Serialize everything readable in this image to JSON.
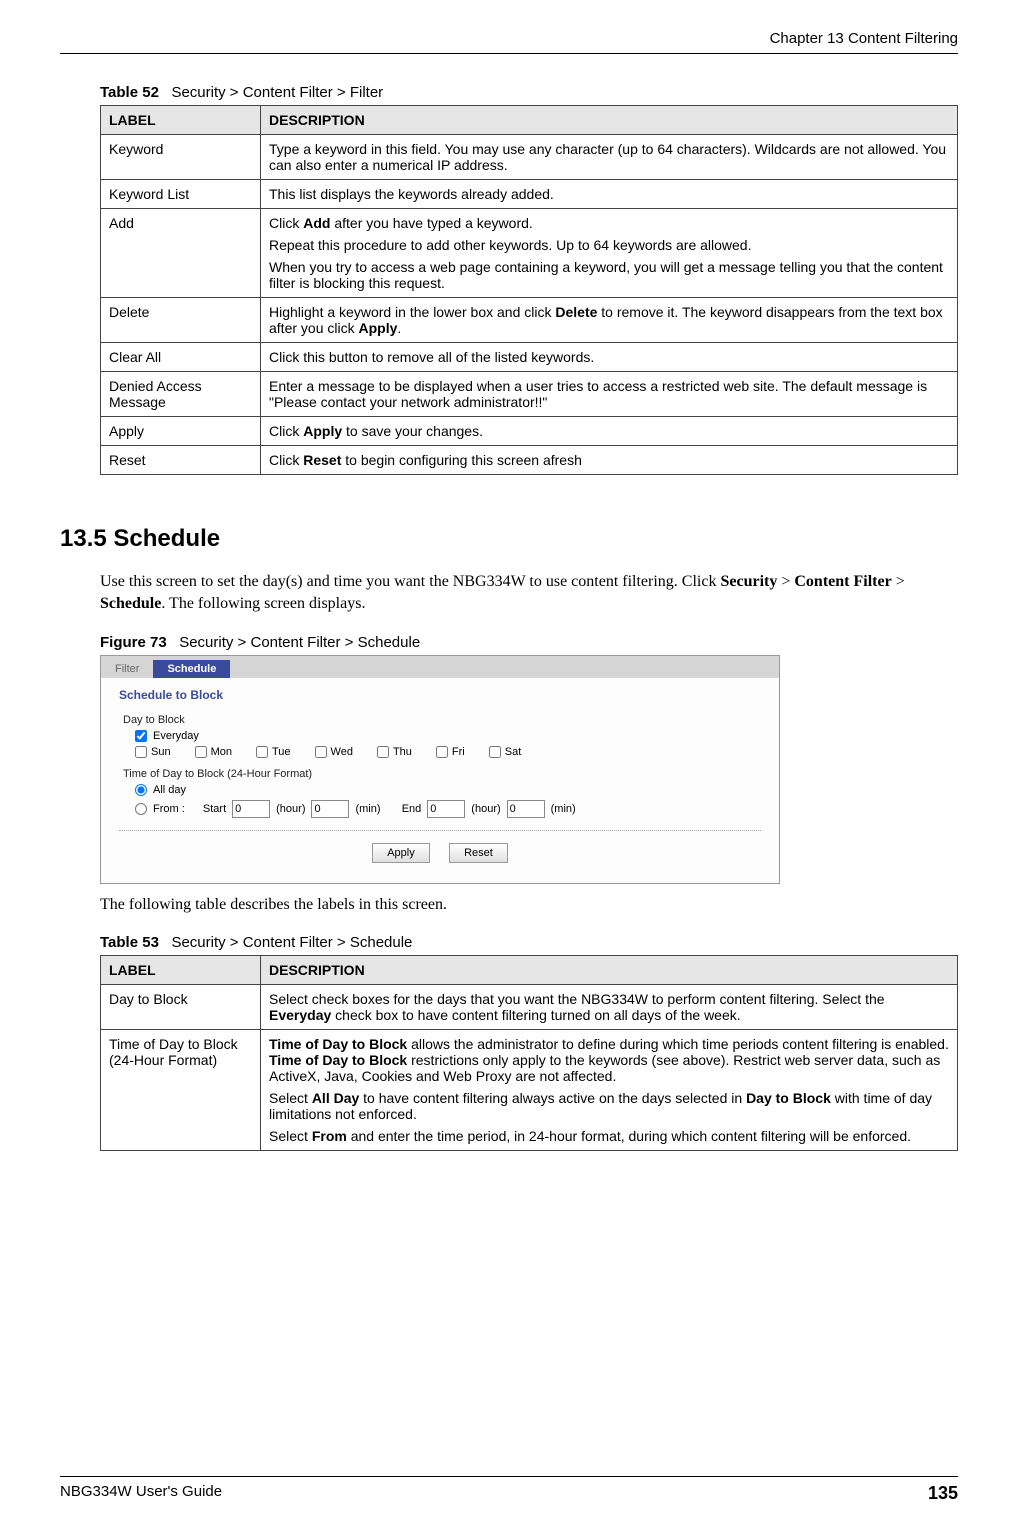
{
  "header": {
    "chapter": "Chapter 13 Content Filtering"
  },
  "table52": {
    "caption_prefix": "Table 52",
    "caption_text": "Security > Content Filter > Filter",
    "headers": {
      "label": "LABEL",
      "description": "DESCRIPTION"
    },
    "rows": [
      {
        "label": "Keyword",
        "desc": [
          "Type a keyword in this field. You may use any character (up to 64 characters). Wildcards are not allowed. You can also enter a numerical IP address."
        ]
      },
      {
        "label": "Keyword List",
        "desc": [
          "This list displays the keywords already added."
        ]
      },
      {
        "label": "Add",
        "desc": [
          "Click <b>Add</b> after you have typed a keyword.",
          "Repeat this procedure to add other keywords. Up to 64 keywords are allowed.",
          "When you try to access a web page containing a keyword, you will get a message telling you that the content filter is blocking this request."
        ]
      },
      {
        "label": "Delete",
        "desc": [
          "Highlight a keyword in the lower box and click <b>Delete</b> to remove it. The keyword disappears from the text box after you click <b>Apply</b>."
        ]
      },
      {
        "label": "Clear All",
        "desc": [
          "Click this button to remove all of the listed keywords."
        ]
      },
      {
        "label": "Denied Access Message",
        "desc": [
          "Enter a message to be displayed when a user tries to access a restricted web site. The default message is \"Please contact your network administrator!!\""
        ]
      },
      {
        "label": "Apply",
        "desc": [
          "Click <b>Apply</b> to save your changes."
        ]
      },
      {
        "label": "Reset",
        "desc": [
          "Click <b>Reset</b> to begin configuring this screen afresh"
        ]
      }
    ]
  },
  "section": {
    "heading": "13.5  Schedule",
    "intro": "Use this screen to set the day(s) and time you want the NBG334W to use content filtering. Click <b>Security</b> > <b>Content Filter</b> > <b>Schedule</b>. The following screen displays."
  },
  "figure": {
    "caption_prefix": "Figure 73",
    "caption_text": "Security > Content Filter > Schedule",
    "tabs": {
      "filter": "Filter",
      "schedule": "Schedule"
    },
    "panel_title": "Schedule to Block",
    "day_label": "Day to Block",
    "days": {
      "everyday": "Everyday",
      "sun": "Sun",
      "mon": "Mon",
      "tue": "Tue",
      "wed": "Wed",
      "thu": "Thu",
      "fri": "Fri",
      "sat": "Sat"
    },
    "time_label": "Time of Day to Block (24-Hour Format)",
    "allday": "All day",
    "from_label": "From :",
    "start_label": "Start",
    "end_label": "End",
    "hour_unit": "(hour)",
    "min_unit": "(min)",
    "value_zero": "0",
    "apply_btn": "Apply",
    "reset_btn": "Reset"
  },
  "after_figure": "The following table describes the labels in this screen.",
  "table53": {
    "caption_prefix": "Table 53",
    "caption_text": "Security > Content Filter > Schedule",
    "headers": {
      "label": "LABEL",
      "description": "DESCRIPTION"
    },
    "rows": [
      {
        "label": "Day to Block",
        "desc": [
          "Select check boxes for the days that you want the NBG334W to perform content filtering. Select the <b>Everyday</b> check box to have content filtering turned on all days of the week."
        ]
      },
      {
        "label": "Time of Day to Block (24-Hour Format)",
        "desc": [
          "<b>Time of Day to Block</b> allows the administrator to define during which time periods content filtering is enabled. <b>Time of Day to Block</b> restrictions only apply to the keywords (see above). Restrict web server data, such as ActiveX, Java, Cookies and Web Proxy are not affected.",
          "Select  <b>All Day</b> to have content filtering always active on the days selected in <b>Day to Block</b> with time of day limitations not enforced.",
          "Select <b>From</b> and enter the time period, in 24-hour format, during which content filtering will be enforced."
        ]
      }
    ]
  },
  "footer": {
    "guide": "NBG334W User's Guide",
    "page": "135"
  }
}
